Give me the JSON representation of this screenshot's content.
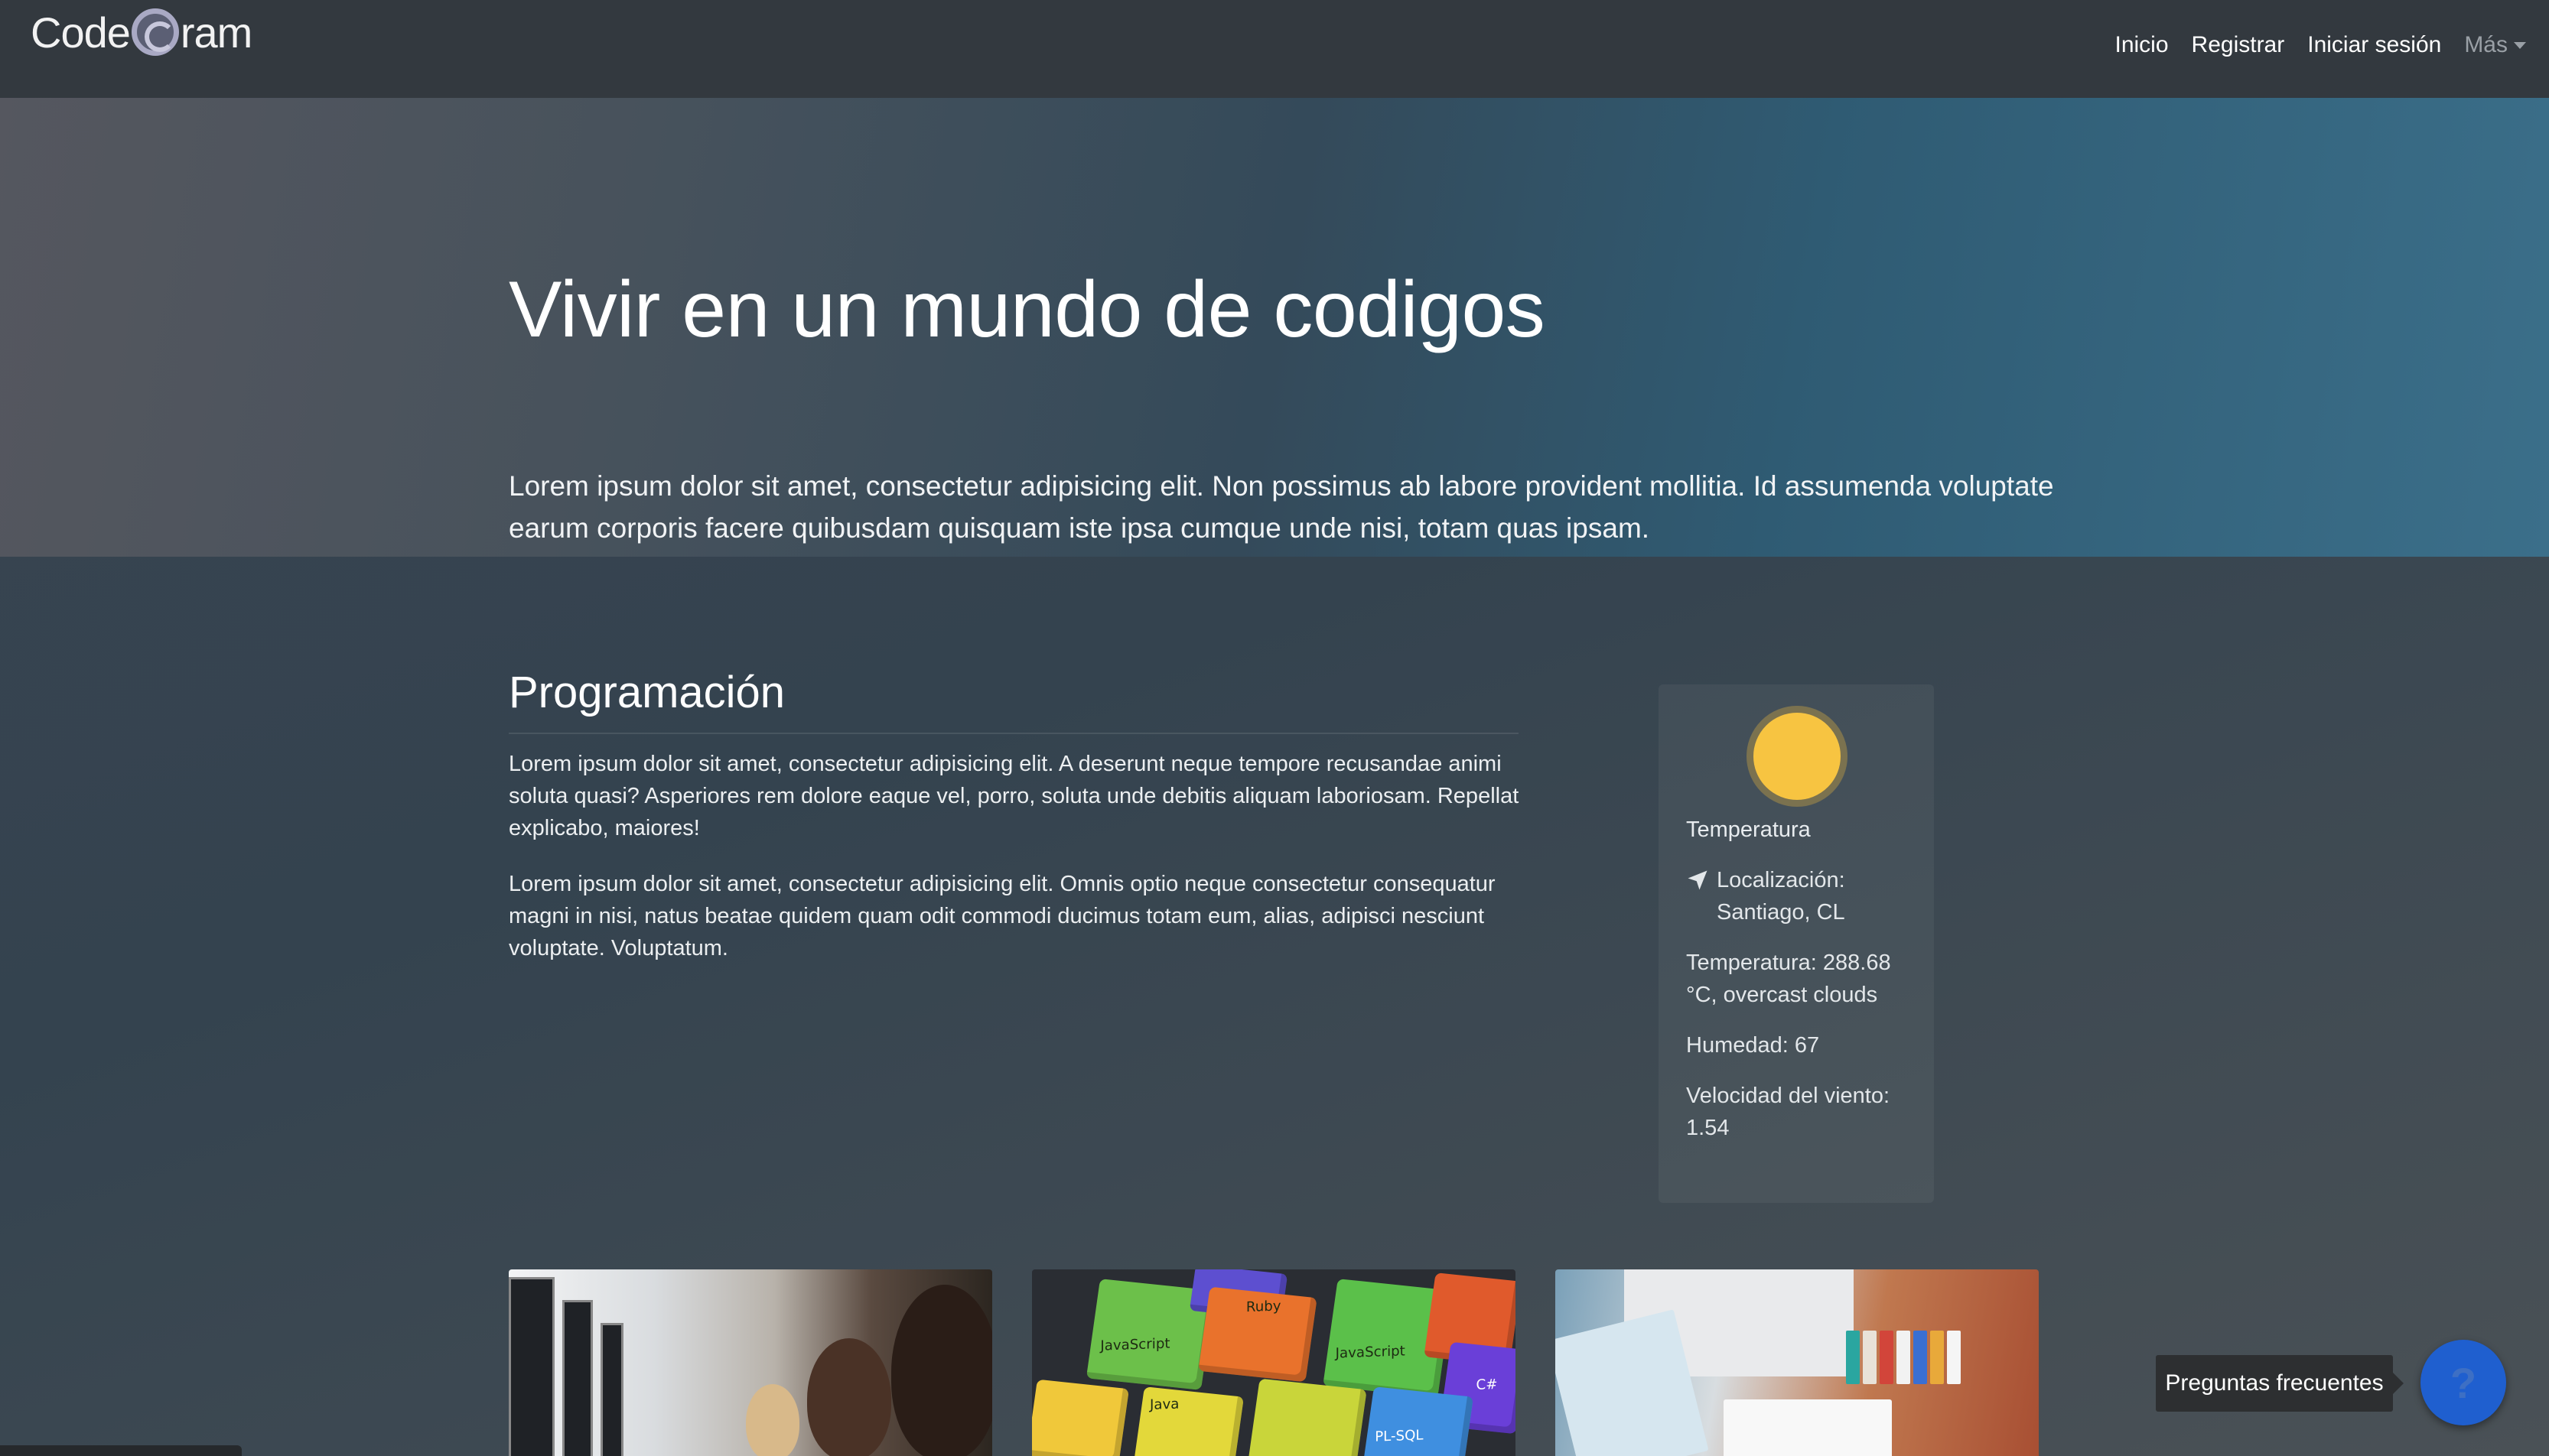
{
  "navbar": {
    "brand": {
      "before_logo": "Code",
      "after_logo": "ram"
    },
    "links": [
      {
        "label": "Inicio"
      },
      {
        "label": "Registrar"
      },
      {
        "label": "Iniciar sesión"
      },
      {
        "label": "Más"
      }
    ]
  },
  "hero": {
    "title": "Vivir en un mundo de codigos",
    "text": "Lorem ipsum dolor sit amet, consectetur adipisicing elit. Non possimus ab labore provident mollitia. Id assumenda voluptate earum corporis facere quibusdam quisquam iste ipsa cumque unde nisi, totam quas ipsam."
  },
  "main": {
    "title": "Programación",
    "paragraphs": [
      "Lorem ipsum dolor sit amet, consectetur adipisicing elit. A deserunt neque tempore recusandae animi soluta quasi? Asperiores rem dolore eaque vel, porro, soluta unde debitis aliquam laboriosam. Repellat explicabo, maiores!",
      "Lorem ipsum dolor sit amet, consectetur adipisicing elit. Omnis optio neque consectetur consequatur magni in nisi, natus beatae quidem quam odit commodi ducimus totam eum, alias, adipisci nesciunt voluptate. Voluptatum."
    ]
  },
  "weather": {
    "label": "Temperatura",
    "location": "Localización: Santiago, CL",
    "temperature": "Temperatura: 288.68 °C, overcast clouds",
    "humidity": "Humedad: 67",
    "wind": "Velocidad del viento: 1.54",
    "sun_color": "#f7c441"
  },
  "cards": {
    "cube_labels": [
      "JavaScript",
      "JavaScript",
      "Ruby",
      "JavaScript",
      "C#",
      "PL-SQL",
      "Java"
    ]
  },
  "faq": {
    "label": "Preguntas frecuentes",
    "button_icon": "question-icon",
    "button_glyph": "?",
    "button_color": "#1f5fcf"
  }
}
